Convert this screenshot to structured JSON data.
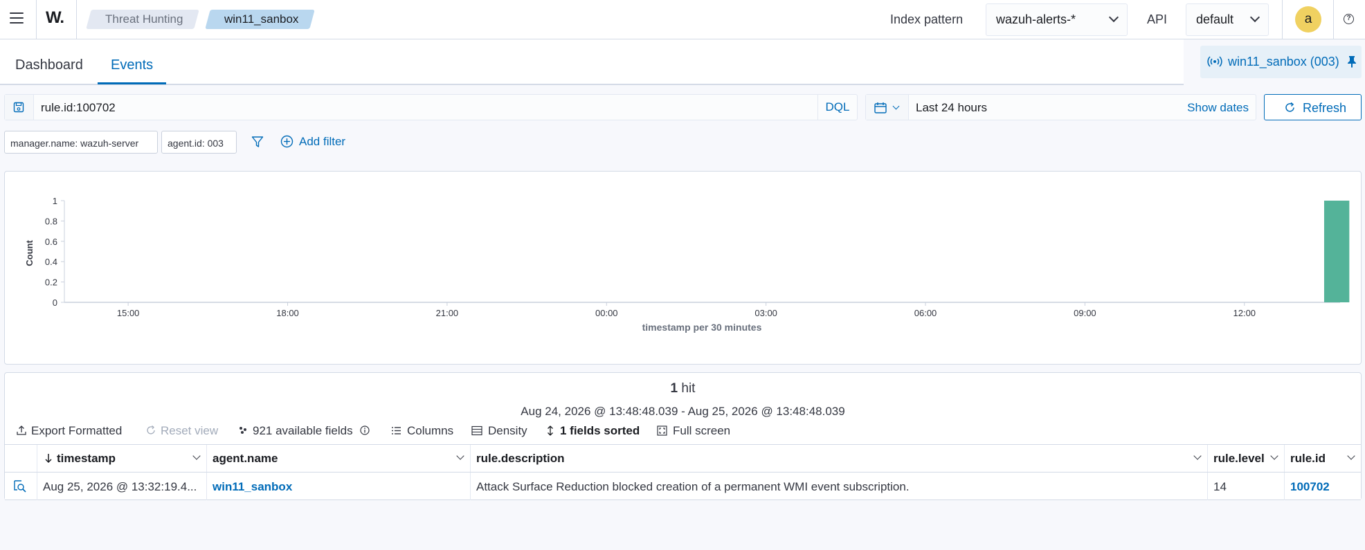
{
  "header": {
    "logo": "W.",
    "breadcrumbs": [
      "Threat Hunting",
      "win11_sanbox"
    ],
    "index_pattern_label": "Index pattern",
    "index_pattern_value": "wazuh-alerts-*",
    "api_label": "API",
    "api_value": "default",
    "avatar_letter": "a"
  },
  "tabs": [
    {
      "label": "Dashboard",
      "active": false
    },
    {
      "label": "Events",
      "active": true
    }
  ],
  "agent_pill": "win11_sanbox (003)",
  "search": {
    "query": "rule.id:100702",
    "language": "DQL",
    "time_range": "Last 24 hours",
    "show_dates": "Show dates",
    "refresh": "Refresh"
  },
  "filters": [
    "manager.name: wazuh-server",
    "agent.id: 003"
  ],
  "add_filter": "Add filter",
  "chart_data": {
    "type": "bar",
    "ylabel": "Count",
    "xlabel": "timestamp per 30 minutes",
    "ylim": [
      0,
      1
    ],
    "yticks": [
      "0",
      "0.2",
      "0.4",
      "0.6",
      "0.8",
      "1"
    ],
    "xticks": [
      "15:00",
      "18:00",
      "21:00",
      "00:00",
      "03:00",
      "06:00",
      "09:00",
      "12:00"
    ],
    "series": [
      {
        "x": "13:30",
        "values": [
          1
        ]
      }
    ],
    "color": "#54b399"
  },
  "results": {
    "hits_count": "1",
    "hits_label": "hit",
    "date_range": "Aug 24, 2026 @ 13:48:48.039 - Aug 25, 2026 @ 13:48:48.039",
    "toolbar": {
      "export": "Export Formatted",
      "reset": "Reset view",
      "fields": "921 available fields",
      "columns": "Columns",
      "density": "Density",
      "sorted": "1 fields sorted",
      "fullscreen": "Full screen"
    },
    "columns": [
      "timestamp",
      "agent.name",
      "rule.description",
      "rule.level",
      "rule.id"
    ],
    "rows": [
      {
        "timestamp": "Aug 25, 2026 @ 13:32:19.4...",
        "agent_name": "win11_sanbox",
        "rule_description": "Attack Surface Reduction blocked creation of a permanent WMI event subscription.",
        "rule_level": "14",
        "rule_id": "100702"
      }
    ]
  }
}
